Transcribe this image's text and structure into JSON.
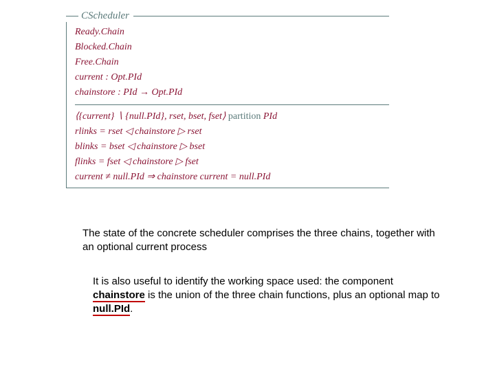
{
  "schema": {
    "title": "CScheduler",
    "decl": {
      "l1": "Ready.Chain",
      "l2": "Blocked.Chain",
      "l3": "Free.Chain",
      "l4": "current : Opt.PId",
      "l5": "chainstore : PId → Opt.PId"
    },
    "pred": {
      "p1a": "⟨{current} ∖ {null.PId}, rset, bset, fset⟩ ",
      "p1kw": "partition",
      "p1b": " PId",
      "p2": "rlinks = rset ◁ chainstore ▷ rset",
      "p3": "blinks = bset ◁ chainstore ▷ bset",
      "p4": "flinks = fset ◁ chainstore ▷ fset",
      "p5": "current ≠ null.PId ⇒ chainstore current = null.PId"
    }
  },
  "caption1": "The state of the concrete scheduler comprises the three chains, together with an optional current process",
  "caption2": {
    "a": "It is also useful to identify the working space used: the component ",
    "term1": "chainstore",
    "b": " is the union of the three chain functions, plus an optional map to ",
    "term2": "null.PId",
    "c": "."
  }
}
